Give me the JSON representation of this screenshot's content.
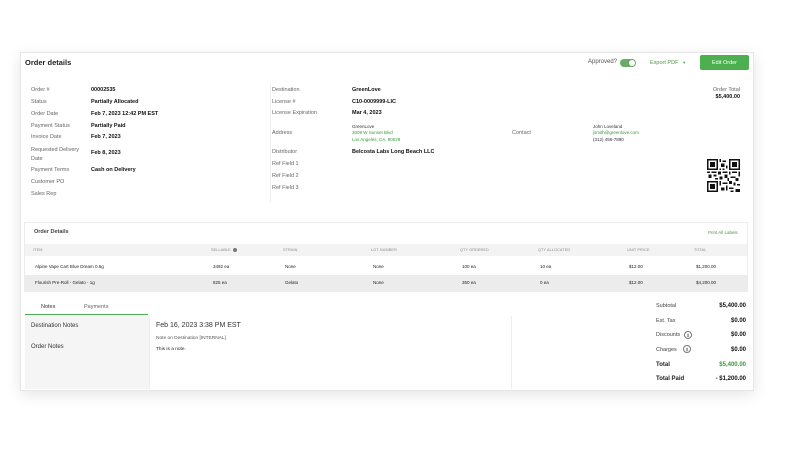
{
  "header": {
    "title": "Order details",
    "approved_label": "Approved?",
    "export_label": "Export PDF",
    "export_caret": "▾",
    "edit_label": "Edit Order"
  },
  "order_info": [
    {
      "label": "Order #",
      "value": "00002535"
    },
    {
      "label": "Status",
      "value": "Partially Allocated"
    },
    {
      "label": "Order Date",
      "value": "Feb 7, 2023 12:42 PM EST"
    },
    {
      "label": "Payment Status",
      "value": "Partially Paid"
    },
    {
      "label": "Invoice Date",
      "value": "Feb 7, 2023"
    },
    {
      "label": "Requested Delivery\nDate",
      "value": "Feb 8, 2023"
    },
    {
      "label": "Payment Terms",
      "value": "Cash on Delivery"
    },
    {
      "label": "Customer PO",
      "value": ""
    },
    {
      "label": "Sales Rep",
      "value": ""
    }
  ],
  "destination": {
    "label": "Destination",
    "value": "GreenLove",
    "license_label": "License #",
    "license": "C10-0009999-LIC",
    "expiration_label": "License Expiration",
    "expiration": "Mar 4, 2023",
    "address_label": "Address",
    "address_name": "GreenLove",
    "address_line1": "3009 W Sunset Blvd",
    "address_line2": "Los Angeles, CA, 90028",
    "distributor_label": "Distributor",
    "distributor": "Belcosta Labs Long Beach LLC",
    "ref1": "Ref Field 1",
    "ref2": "Ref Field 2",
    "ref3": "Ref Field 3"
  },
  "contact": {
    "label": "Contact",
    "name": "John Loveland",
    "email": "jsmith@greenlove.com",
    "phone": "(312) 456-7890"
  },
  "totals_top": {
    "label": "Order Total",
    "value": "$5,400.00"
  },
  "order_details": {
    "title": "Order Details",
    "print_all": "Print All Labels",
    "columns": [
      "ITEM",
      "SELLABLE",
      "STRAIN",
      "LOT NUMBER",
      "QTY ORDERED",
      "QTY ALLOCATED",
      "UNIT PRICE",
      "TOTAL"
    ],
    "rows": [
      [
        "Alpine Vape Cart Blue Dream 0.5g",
        "3492 ea",
        "None",
        "None",
        "100 ea",
        "10 ea",
        "$12.00",
        "$1,200.00"
      ],
      [
        "Flourish Pre-Roll - Gelato - 1g",
        "825 ea",
        "Gelato",
        "None",
        "350 ea",
        "0 ea",
        "$12.00",
        "$4,200.00"
      ]
    ]
  },
  "tabs": {
    "notes": "Notes",
    "payments": "Payments"
  },
  "notes": {
    "items": [
      "Destination Notes",
      "Order Notes"
    ],
    "date": "Feb 16, 2023 3:38 PM EST",
    "meta": "Note on Destination [INTERNAL]",
    "text": "This is a note."
  },
  "summary": {
    "subtotal_label": "Subtotal",
    "subtotal": "$5,400.00",
    "tax_label": "Est. Tax",
    "tax": "$0.00",
    "discounts_label": "Discounts",
    "discounts": "$0.00",
    "charges_label": "Charges",
    "charges": "$0.00",
    "total_label": "Total",
    "total": "$5,400.00",
    "paid_label": "Total Paid",
    "paid": "- $1,200.00",
    "dollar_glyph": "$"
  },
  "colors": {
    "accent": "#4caf50",
    "link": "#3a9a3a"
  }
}
